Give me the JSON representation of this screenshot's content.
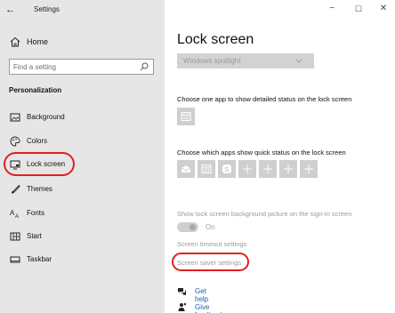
{
  "window": {
    "title": "Settings",
    "controls": {
      "minimize": "−",
      "maximize": "☐",
      "close": "✕"
    }
  },
  "sidebar": {
    "back_icon": "back-arrow-icon",
    "home_label": "Home",
    "search_placeholder": "Find a setting",
    "section_title": "Personalization",
    "items": [
      {
        "label": "Background",
        "icon": "picture-icon"
      },
      {
        "label": "Colors",
        "icon": "palette-icon"
      },
      {
        "label": "Lock screen",
        "icon": "monitor-icon",
        "selected": true
      },
      {
        "label": "Themes",
        "icon": "brush-icon"
      },
      {
        "label": "Fonts",
        "icon": "font-icon"
      },
      {
        "label": "Start",
        "icon": "grid-icon"
      },
      {
        "label": "Taskbar",
        "icon": "taskbar-icon"
      }
    ]
  },
  "main": {
    "title": "Lock screen",
    "background_select": "Windows spotlight",
    "detailed_status_caption": "Choose one app to show detailed status on the lock screen",
    "quick_status_caption": "Choose which apps show quick status on the lock screen",
    "quick_tiles": [
      "mail-icon",
      "calendar-icon",
      "skype-icon",
      "plus-icon",
      "plus-icon",
      "plus-icon",
      "plus-icon"
    ],
    "signin_bg_caption": "Show lock screen background picture on the sign-in screen",
    "toggle_state": "On",
    "timeout_link": "Screen timeout settings",
    "screensaver_link": "Screen saver settings",
    "get_help": "Get help",
    "give_feedback": "Give feedback"
  },
  "colors": {
    "sidebar_bg": "#e6e6e6",
    "highlight_red": "#e02020",
    "link_blue": "#1a5fb4"
  }
}
